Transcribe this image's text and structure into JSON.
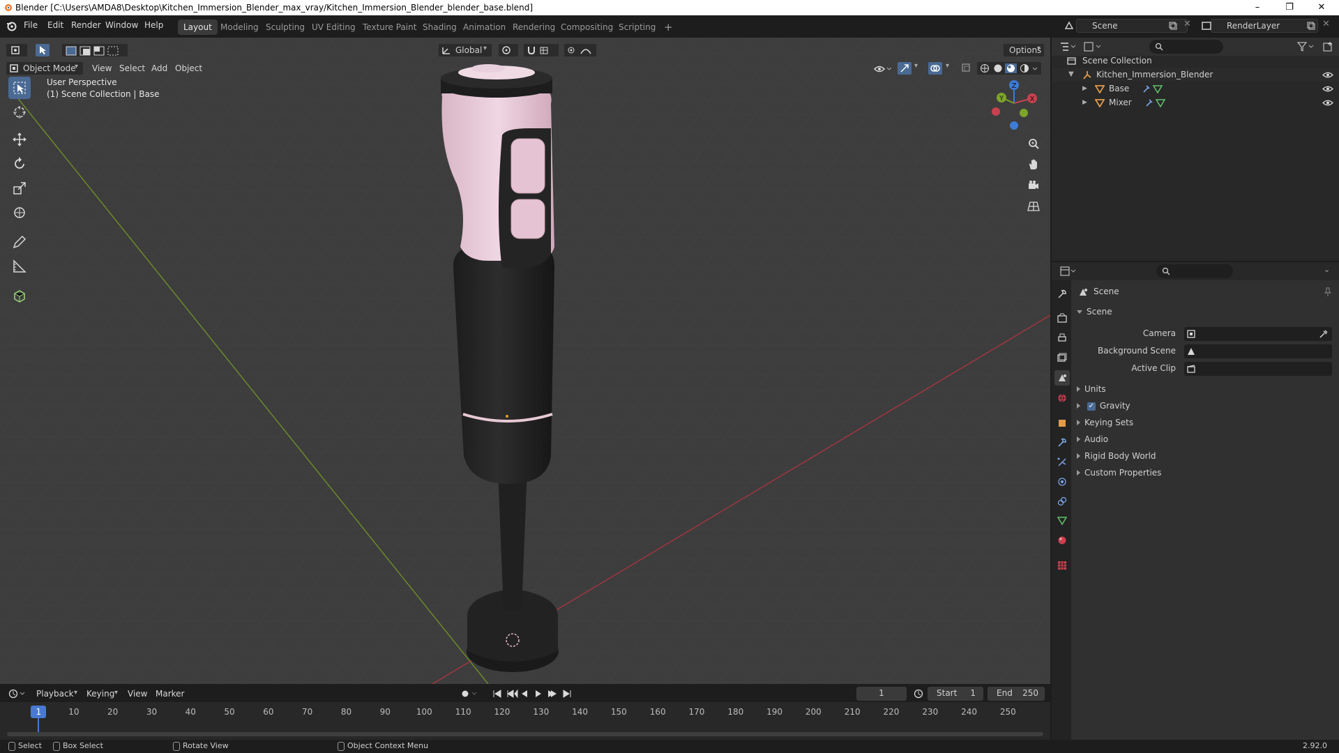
{
  "window": {
    "title": "Blender [C:\\Users\\AMDA8\\Desktop\\Kitchen_Immersion_Blender_max_vray/Kitchen_Immersion_Blender_blender_base.blend]",
    "minimize": "–",
    "maximize": "❐",
    "close": "✕"
  },
  "menu": [
    "File",
    "Edit",
    "Render",
    "Window",
    "Help"
  ],
  "workspaces": [
    "Layout",
    "Modeling",
    "Sculpting",
    "UV Editing",
    "Texture Paint",
    "Shading",
    "Animation",
    "Rendering",
    "Compositing",
    "Scripting"
  ],
  "workspace_add": "+",
  "scene_selector": {
    "value": "Scene"
  },
  "view_layer_selector": {
    "value": "RenderLayer"
  },
  "viewport_header": {
    "transform_orientation": "Global",
    "options": "Options",
    "mode": "Object Mode",
    "menus": [
      "View",
      "Select",
      "Add",
      "Object"
    ]
  },
  "viewport_overlay": {
    "view_name": "User Perspective",
    "collection_info": "(1) Scene Collection | Base"
  },
  "gizmo": {
    "x": "X",
    "y": "Y",
    "z": "Z"
  },
  "outliner": {
    "root": "Scene Collection",
    "collection": "Kitchen_Immersion_Blender",
    "objects": [
      "Base",
      "Mixer"
    ]
  },
  "properties": {
    "breadcrumb": "Scene",
    "panel_title": "Scene",
    "fields": [
      {
        "label": "Camera"
      },
      {
        "label": "Background Scene"
      },
      {
        "label": "Active Clip"
      }
    ],
    "subpanels": [
      "Units",
      "Gravity",
      "Keying Sets",
      "Audio",
      "Rigid Body World",
      "Custom Properties"
    ],
    "gravity_checked": true
  },
  "timeline": {
    "menus": [
      "Playback",
      "Keying",
      "View",
      "Marker"
    ],
    "current_frame": "1",
    "start_label": "Start",
    "start": "1",
    "end_label": "End",
    "end": "250",
    "ticks": [
      "1",
      "10",
      "20",
      "30",
      "40",
      "50",
      "60",
      "70",
      "80",
      "90",
      "100",
      "110",
      "120",
      "130",
      "140",
      "150",
      "160",
      "170",
      "180",
      "190",
      "200",
      "210",
      "220",
      "230",
      "240",
      "250"
    ]
  },
  "statusbar": {
    "select": "Select",
    "box_select": "Box Select",
    "rotate_view": "Rotate View",
    "context_menu": "Object Context Menu",
    "version": "2.92.0"
  },
  "colors": {
    "accent_blue": "#4a6a94",
    "axis_x": "#c8414f",
    "axis_y": "#7da52a",
    "axis_z": "#3d7bd6",
    "body_pink": "#e8c9d6",
    "body_dark": "#252525"
  }
}
